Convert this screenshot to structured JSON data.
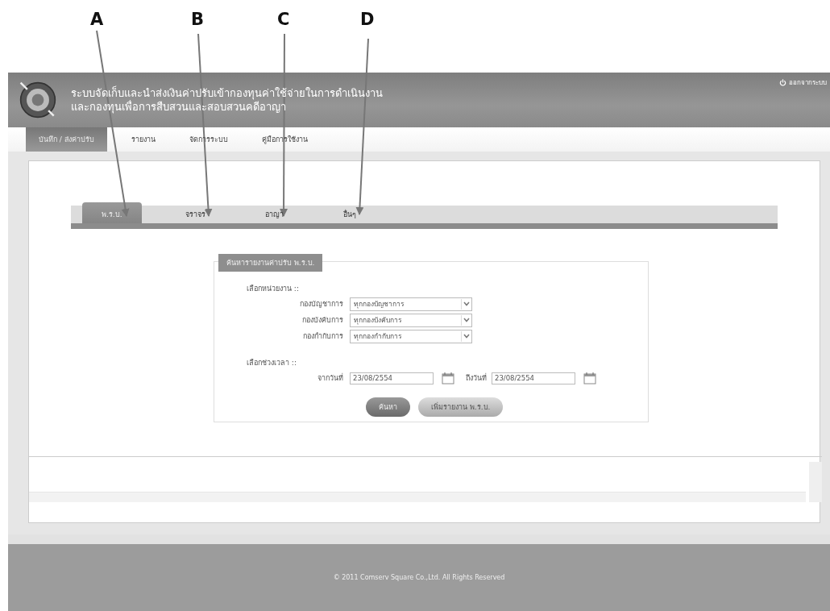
{
  "callouts": [
    {
      "label": "A"
    },
    {
      "label": "B"
    },
    {
      "label": "C"
    },
    {
      "label": "D"
    }
  ],
  "header": {
    "title_lines": [
      "ระบบจัดเก็บและนำส่งเงินค่าปรับเข้ากองทุนค่าใช้จ่ายในการดำเนินงาน",
      "และกองทุนเพื่อการสืบสวนและสอบสวนคดีอาญา"
    ],
    "logout": "ออกจากระบบ"
  },
  "menu": [
    {
      "label": "บันทึก / ส่งค่าปรับ",
      "selected": true
    },
    {
      "label": "รายงาน",
      "selected": false
    },
    {
      "label": "จัดการระบบ",
      "selected": false
    },
    {
      "label": "คู่มือการใช้งาน",
      "selected": false
    }
  ],
  "tabs": [
    {
      "label": "พ.ร.บ.",
      "selected": true
    },
    {
      "label": "จราจร",
      "selected": false
    },
    {
      "label": "อาญา",
      "selected": false
    },
    {
      "label": "อื่นๆ",
      "selected": false
    }
  ],
  "form": {
    "legend": "ค้นหารายงานค่าปรับ พ.ร.บ.",
    "unit_heading": "เลือกหน่วยงาน ::",
    "selects": [
      {
        "label": "กองบัญชาการ",
        "value": "ทุกกองบัญชาการ"
      },
      {
        "label": "กองบังคับการ",
        "value": "ทุกกองบังคับการ"
      },
      {
        "label": "กองกำกับการ",
        "value": "ทุกกองกำกับการ"
      }
    ],
    "period_heading": "เลือกช่วงเวลา ::",
    "from_label": "จากวันที่",
    "from_value": "23/08/2554",
    "to_label": "ถึงวันที่",
    "to_value": "23/08/2554",
    "buttons": [
      "ค้นหา",
      "เพิ่มรายงาน พ.ร.บ."
    ]
  },
  "footer": "© 2011 Comserv Square Co.,Ltd. All Rights Reserved"
}
